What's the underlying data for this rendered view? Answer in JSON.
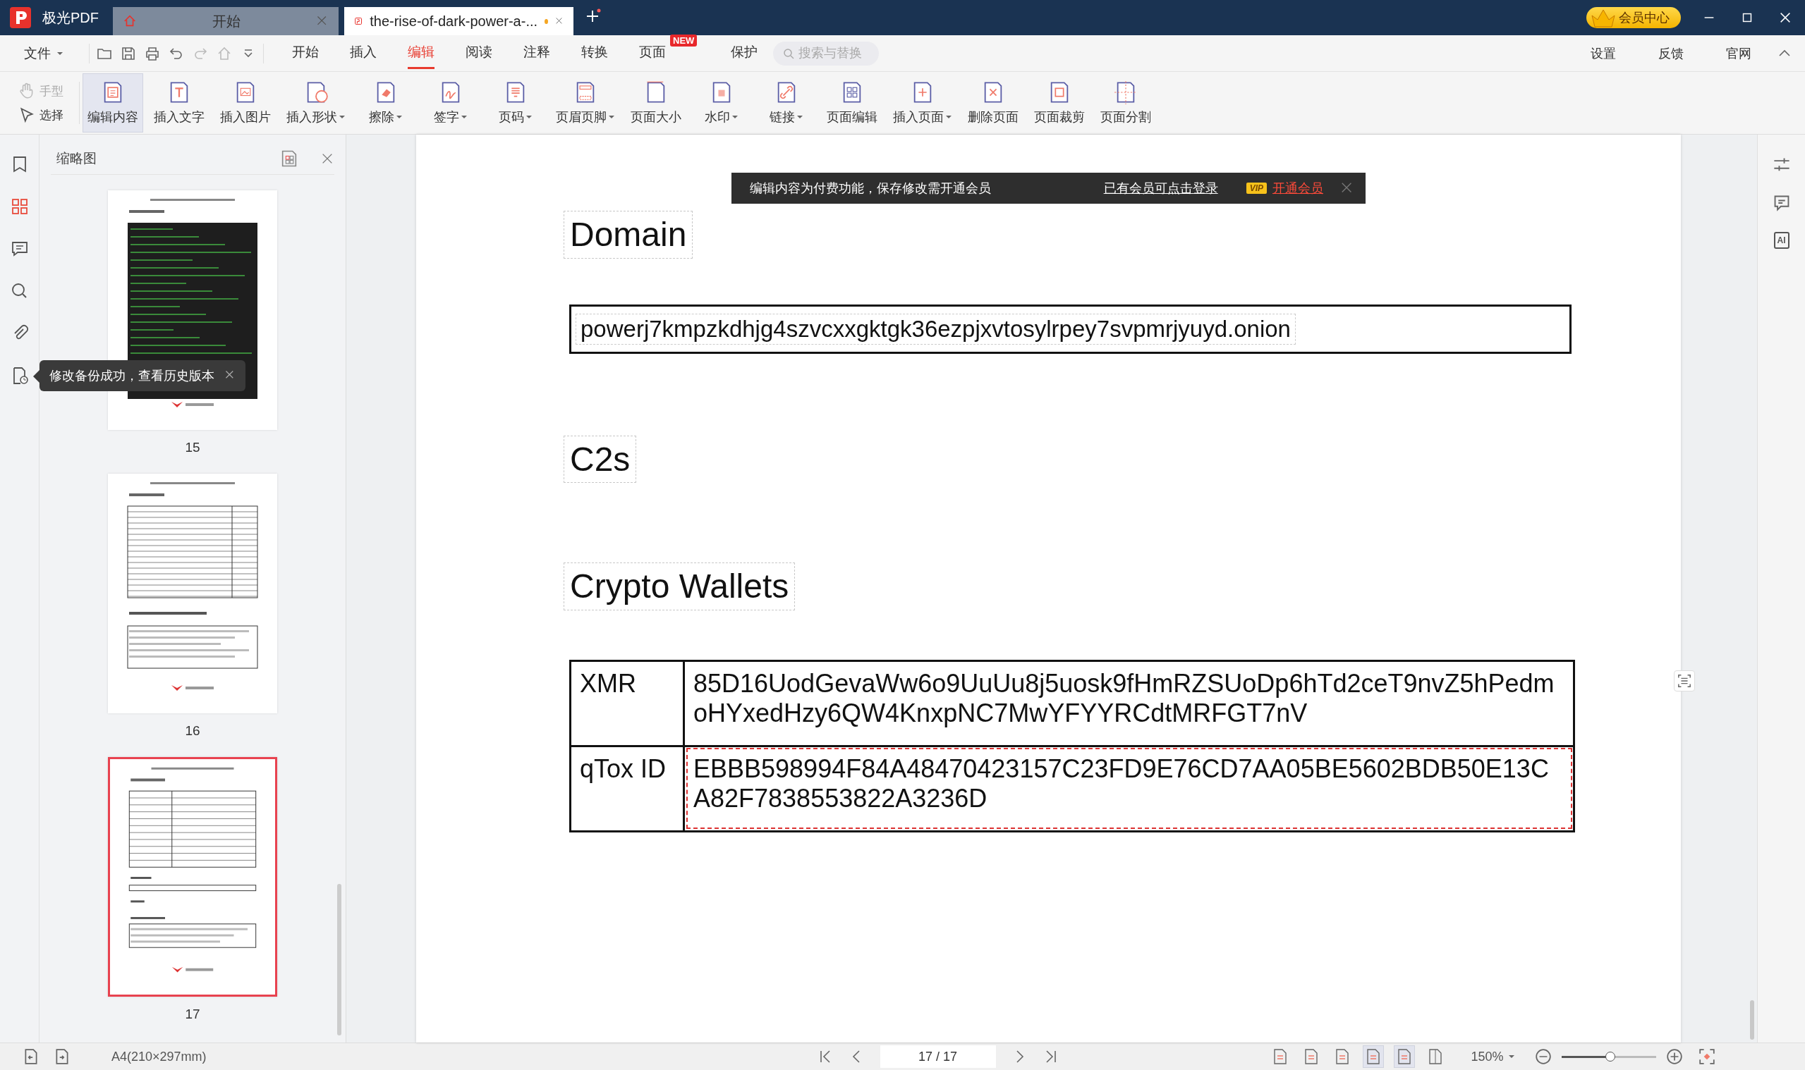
{
  "app": {
    "name": "极光PDF"
  },
  "tabs": [
    {
      "label": "开始",
      "kind": "home",
      "selected": false,
      "unsaved": false
    },
    {
      "label": "the-rise-of-dark-power-a-...",
      "kind": "document",
      "selected": true,
      "unsaved": true
    }
  ],
  "vip_center": "会员中心",
  "menu": {
    "file": "文件",
    "items": [
      {
        "label": "开始",
        "selected": false
      },
      {
        "label": "插入",
        "selected": false
      },
      {
        "label": "编辑",
        "selected": true
      },
      {
        "label": "阅读",
        "selected": false
      },
      {
        "label": "注释",
        "selected": false
      },
      {
        "label": "转换",
        "selected": false
      },
      {
        "label": "页面",
        "selected": false,
        "badge": "NEW"
      },
      {
        "label": "保护",
        "selected": false
      }
    ],
    "search": {
      "placeholder": "搜索与替换"
    },
    "right": [
      "设置",
      "反馈",
      "官网"
    ]
  },
  "toolbar": {
    "modes": [
      {
        "label": "手型",
        "kind": "hand",
        "disabled": true
      },
      {
        "label": "选择",
        "kind": "select",
        "disabled": false
      }
    ],
    "tools": [
      {
        "label": "编辑内容",
        "kind": "edit",
        "selected": true,
        "dropdown": false
      },
      {
        "label": "插入文字",
        "kind": "text",
        "selected": false,
        "dropdown": false
      },
      {
        "label": "插入图片",
        "kind": "image",
        "selected": false,
        "dropdown": false
      },
      {
        "label": "插入形状",
        "kind": "shape",
        "selected": false,
        "dropdown": true
      },
      {
        "label": "擦除",
        "kind": "erase",
        "selected": false,
        "dropdown": true
      },
      {
        "label": "签字",
        "kind": "sign",
        "selected": false,
        "dropdown": true
      },
      {
        "label": "页码",
        "kind": "pagenum",
        "selected": false,
        "dropdown": true
      },
      {
        "label": "页眉页脚",
        "kind": "header",
        "selected": false,
        "dropdown": true
      },
      {
        "label": "页面大小",
        "kind": "size",
        "selected": false,
        "dropdown": false
      },
      {
        "label": "水印",
        "kind": "watermark",
        "selected": false,
        "dropdown": true
      },
      {
        "label": "链接",
        "kind": "link",
        "selected": false,
        "dropdown": true
      },
      {
        "label": "页面编辑",
        "kind": "grid",
        "selected": false,
        "dropdown": false
      },
      {
        "label": "插入页面",
        "kind": "addpage",
        "selected": false,
        "dropdown": true
      },
      {
        "label": "删除页面",
        "kind": "delpage",
        "selected": false,
        "dropdown": false
      },
      {
        "label": "页面裁剪",
        "kind": "crop",
        "selected": false,
        "dropdown": false
      },
      {
        "label": "页面分割",
        "kind": "split",
        "selected": false,
        "dropdown": false
      }
    ]
  },
  "rail": [
    {
      "kind": "bookmark",
      "selected": false
    },
    {
      "kind": "thumbnails",
      "selected": true
    },
    {
      "kind": "comment",
      "selected": false
    },
    {
      "kind": "search",
      "selected": false
    },
    {
      "kind": "attachment",
      "selected": false
    },
    {
      "kind": "history",
      "selected": false
    }
  ],
  "sidebar": {
    "title": "缩略图",
    "toast": "修改备份成功，查看历史版本",
    "thumbnails": [
      {
        "page": "15",
        "kind": "code",
        "selected": false
      },
      {
        "page": "16",
        "kind": "table",
        "selected": false
      },
      {
        "page": "17",
        "kind": "ioc",
        "selected": true
      }
    ]
  },
  "banner": {
    "message": "编辑内容为付费功能，保存修改需开通会员",
    "login_link": "已有会员可点击登录",
    "vip_badge": "VIP",
    "upgrade_link": "开通会员"
  },
  "document": {
    "sections": [
      {
        "heading": "Domain",
        "kind": "box",
        "value": "powerj7kmpzkdhjg4szvcxxgktgk36ezpjxvtosylrpey7svpmrjyuyd.onion"
      },
      {
        "heading": "C2s",
        "kind": "empty"
      },
      {
        "heading": "Crypto Wallets",
        "kind": "table",
        "rows": [
          {
            "label": "XMR",
            "value": "85D16UodGevaWw6o9UuUu8j5uosk9fHmRZSUoDp6hTd2ceT9nvZ5hPedmoHYxedHzy6QW4KnxpNC7MwYFYYRCdtMRFGT7nV",
            "selected": false
          },
          {
            "label": "qTox ID",
            "value": "EBBB598994F84A48470423157C23FD9E76CD7AA05BE5602BDB50E13CA82F7838553822A3236D",
            "selected": true
          }
        ]
      }
    ]
  },
  "right_rail": [
    {
      "kind": "sliders"
    },
    {
      "kind": "chat"
    },
    {
      "kind": "ai",
      "glyph": "AI"
    }
  ],
  "status": {
    "page_size": "A4(210×297mm)",
    "page": "17 / 17",
    "zoom": "150%",
    "zoom_slider": {
      "level": 0.52
    },
    "views": [
      {
        "kind": "actual",
        "selected": false
      },
      {
        "kind": "fitpage",
        "selected": false
      },
      {
        "kind": "fitwidth",
        "selected": false
      },
      {
        "kind": "continuous",
        "selected": true
      },
      {
        "kind": "single",
        "selected": true
      },
      {
        "kind": "double",
        "selected": false
      }
    ]
  }
}
